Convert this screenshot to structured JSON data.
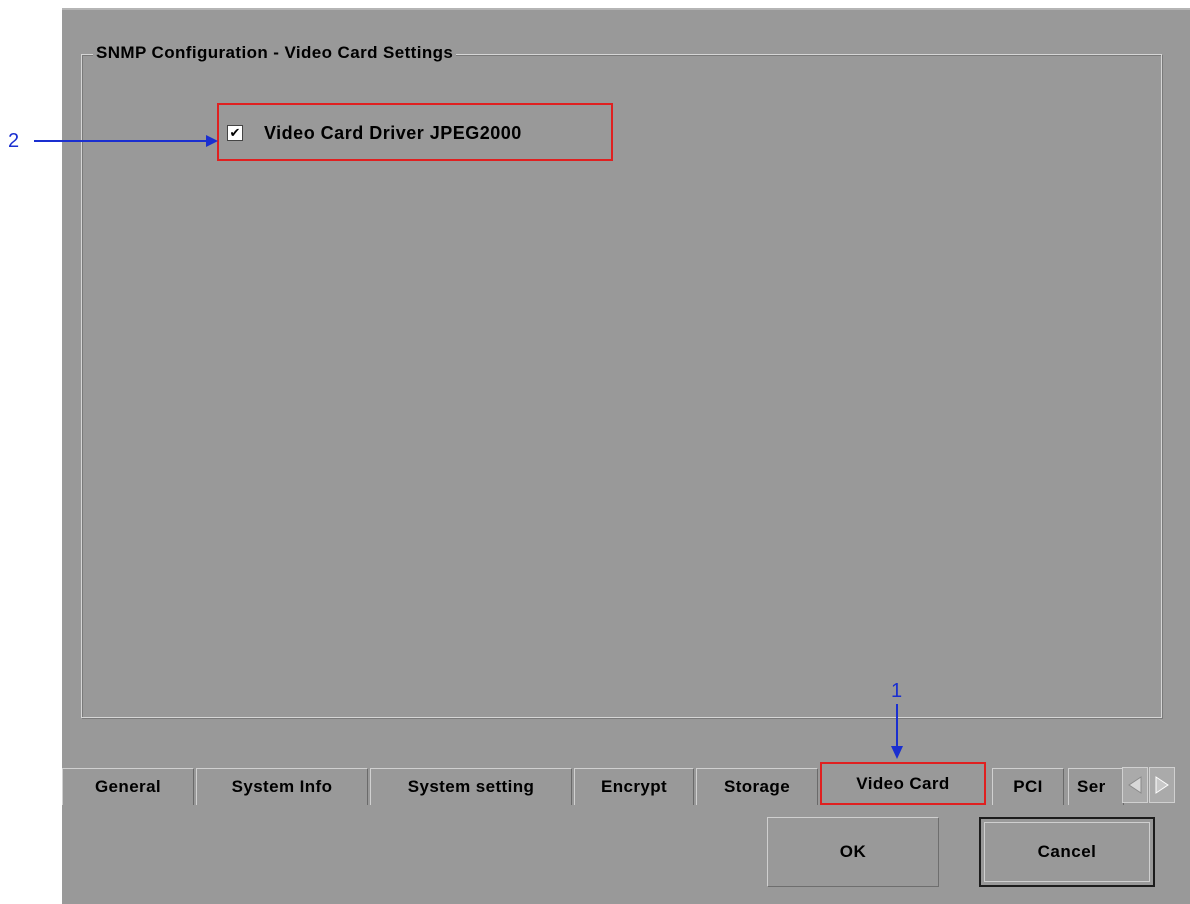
{
  "dialog": {
    "group_title": "SNMP Configuration - Video Card Settings",
    "checkbox": {
      "label": "Video Card Driver JPEG2000",
      "checked": true,
      "check_glyph": "✔"
    },
    "tabs": [
      {
        "label": "General",
        "active": false
      },
      {
        "label": "System Info",
        "active": false
      },
      {
        "label": "System setting",
        "active": false
      },
      {
        "label": "Encrypt",
        "active": false
      },
      {
        "label": "Storage",
        "active": false
      },
      {
        "label": "Video Card",
        "active": true
      },
      {
        "label": "PCI",
        "active": false
      },
      {
        "label": "Ser",
        "active": false
      }
    ],
    "tab_scroll_icons": [
      "scroll-left-icon",
      "scroll-right-icon"
    ],
    "buttons": {
      "ok": "OK",
      "cancel": "Cancel"
    }
  },
  "annotations": {
    "marker_1": "1",
    "marker_2": "2",
    "arrow_color": "#1a2fd0",
    "highlight_color": "#e02020"
  }
}
